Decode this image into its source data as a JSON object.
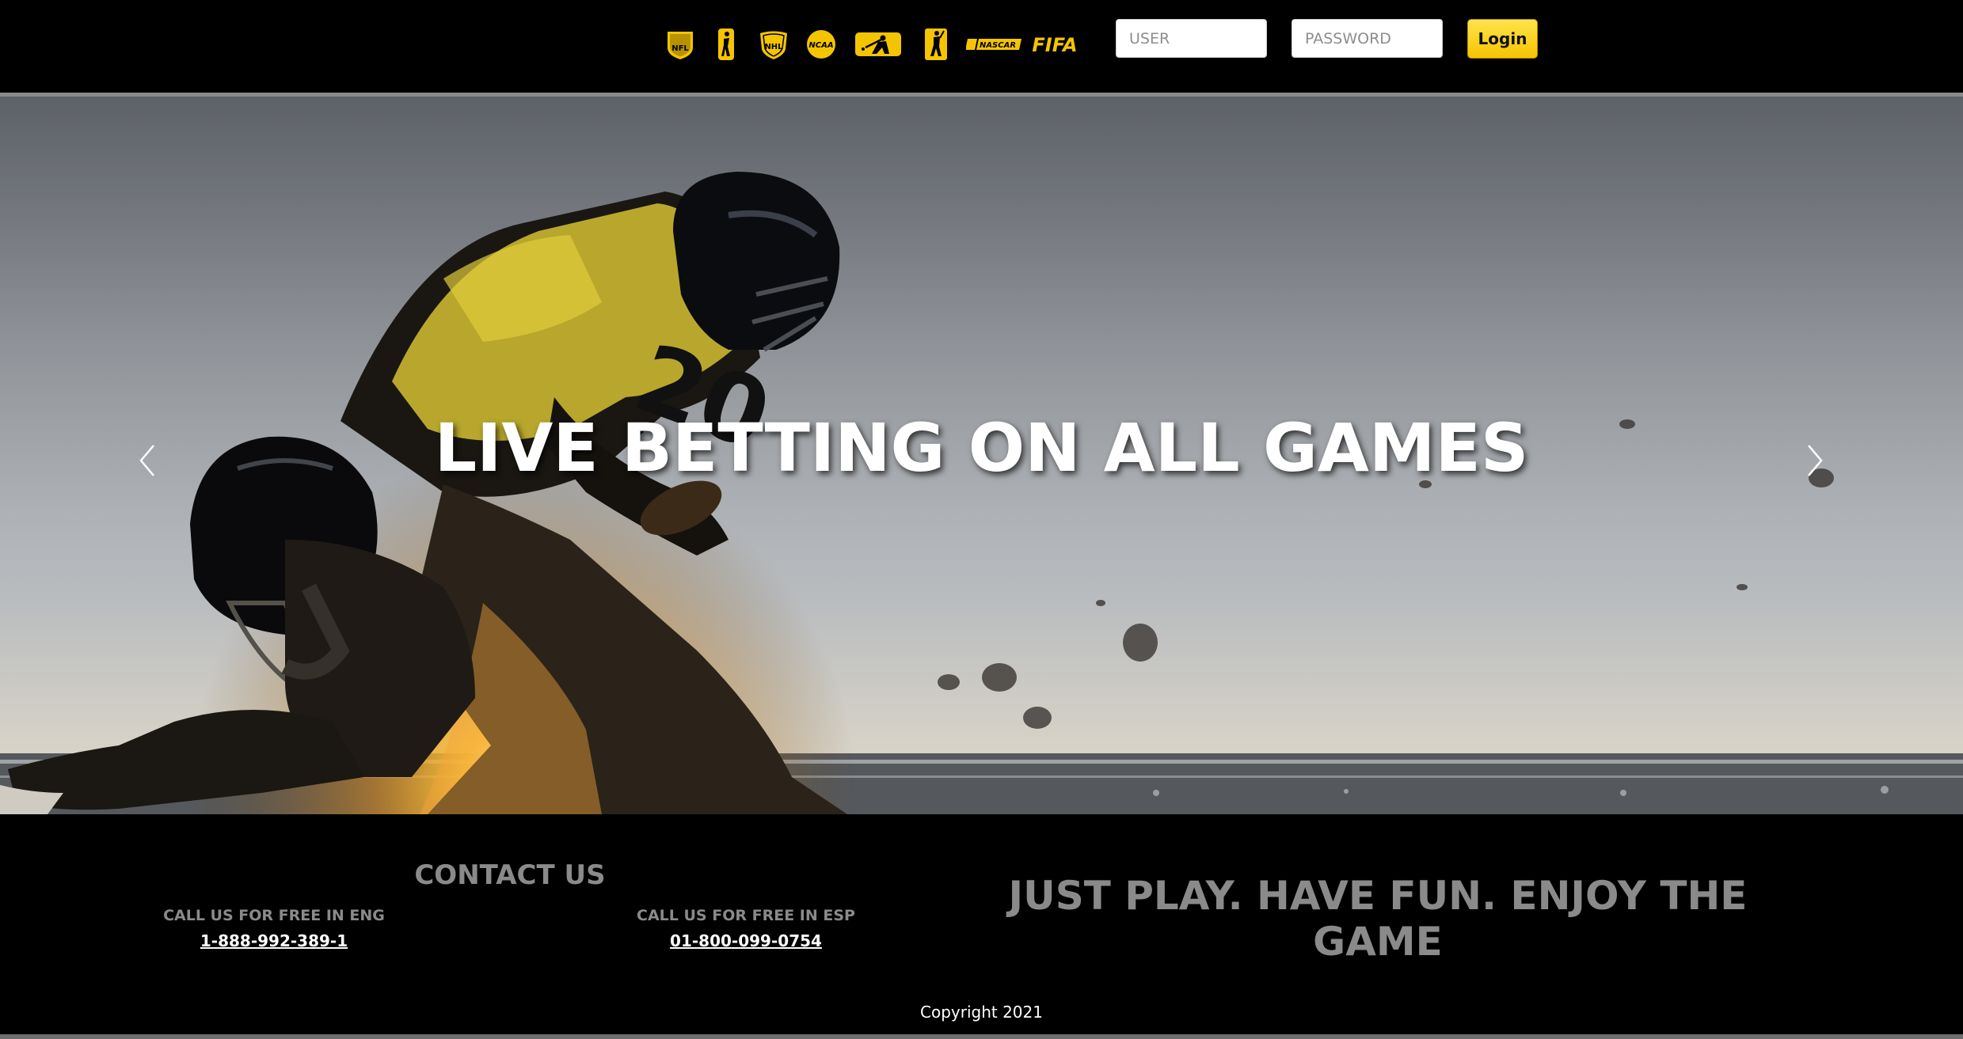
{
  "header": {
    "leagues": [
      {
        "name": "NFL",
        "icon": "nfl-shield-icon"
      },
      {
        "name": "NBA",
        "icon": "nba-player-icon"
      },
      {
        "name": "NHL",
        "icon": "nhl-shield-icon"
      },
      {
        "name": "NCAA",
        "icon": "ncaa-disc-icon"
      },
      {
        "name": "MLB",
        "icon": "mlb-batter-icon"
      },
      {
        "name": "PGA TOUR",
        "icon": "pga-golfer-icon"
      },
      {
        "name": "NASCAR",
        "icon": "nascar-wordmark-icon"
      },
      {
        "name": "FIFA",
        "icon": "fifa-wordmark-icon"
      }
    ],
    "user_placeholder": "USER",
    "password_placeholder": "PASSWORD",
    "login_label": "Login"
  },
  "hero": {
    "title": "LIVE BETTING ON ALL GAMES",
    "prev_icon": "chevron-left-icon",
    "next_icon": "chevron-right-icon"
  },
  "footer": {
    "contact_title": "CONTACT US",
    "eng_label": "CALL US FOR FREE IN ENG",
    "eng_phone": "1-888-992-389-1",
    "esp_label": "CALL US FOR FREE IN ESP",
    "esp_phone": "01-800-099-0754",
    "tagline": "JUST PLAY. HAVE FUN. ENJOY THE GAME",
    "copyright": "Copyright 2021"
  },
  "colors": {
    "accent_yellow": "#f5c400",
    "footer_gray_text": "#8a8a8a",
    "background": "#000000"
  }
}
